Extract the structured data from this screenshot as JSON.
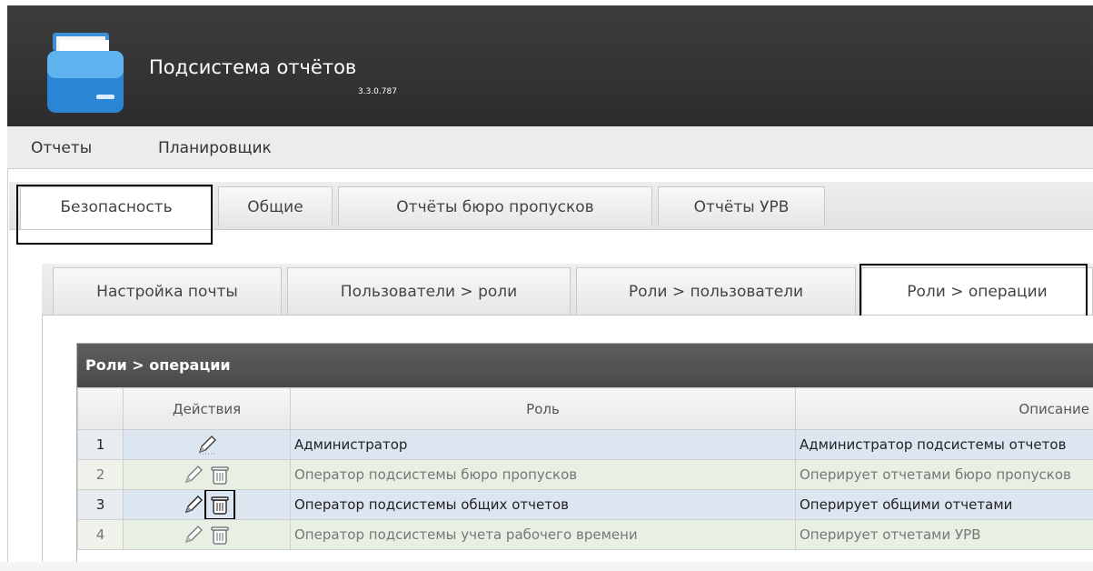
{
  "app": {
    "title": "Подсистема отчётов",
    "version": "3.3.0.787"
  },
  "top_menu": [
    {
      "label": "Отчеты"
    },
    {
      "label": "Планировщик"
    }
  ],
  "tabs": [
    {
      "label": "Безопасность",
      "active": true
    },
    {
      "label": "Общие"
    },
    {
      "label": "Отчёты бюро пропусков"
    },
    {
      "label": "Отчёты УРВ"
    }
  ],
  "subtabs": [
    {
      "label": "Настройка почты"
    },
    {
      "label": "Пользователи > роли"
    },
    {
      "label": "Роли > пользователи"
    },
    {
      "label": "Роли > операции",
      "active": true
    }
  ],
  "grid": {
    "title": "Роли > операции",
    "columns": [
      "",
      "Действия",
      "Роль",
      "Описание"
    ],
    "rows": [
      {
        "num": "1",
        "actions": [
          "edit-icon"
        ],
        "role": "Администратор",
        "description": "Администратор подсистемы отчетов"
      },
      {
        "num": "2",
        "actions": [
          "edit-icon",
          "delete-icon"
        ],
        "role": "Оператор подсистемы бюро пропусков",
        "description": "Оперирует отчетами бюро пропусков"
      },
      {
        "num": "3",
        "actions": [
          "edit-icon",
          "delete-icon"
        ],
        "role": "Оператор подсистемы общих отчетов",
        "description": "Оперирует общими отчетами"
      },
      {
        "num": "4",
        "actions": [
          "edit-icon",
          "delete-icon"
        ],
        "role": "Оператор подсистемы учета рабочего времени",
        "description": "Оперирует отчетами УРВ"
      }
    ]
  },
  "colors": {
    "header_bg": "#333333",
    "selected_row": "#dce6f0",
    "alt_row": "#e8f0e4"
  }
}
